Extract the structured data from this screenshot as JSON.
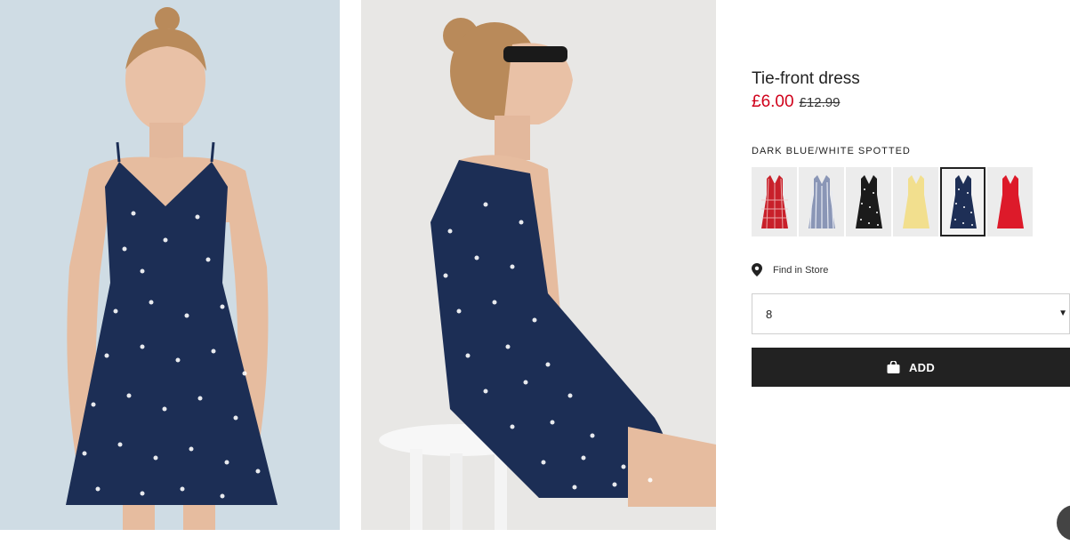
{
  "product": {
    "title": "Tie-front dress",
    "price_now": "£6.00",
    "price_was": "£12.99",
    "color_label": "DARK BLUE/WHITE SPOTTED"
  },
  "swatches": [
    {
      "name": "red-check",
      "color": "#c8202a",
      "selected": false
    },
    {
      "name": "blue-stripe",
      "color": "#8a96b6",
      "selected": false
    },
    {
      "name": "black-spotted",
      "color": "#1b1b1b",
      "selected": false
    },
    {
      "name": "yellow",
      "color": "#f2df8e",
      "selected": false
    },
    {
      "name": "dark-blue-spotted",
      "color": "#1e2f56",
      "selected": true
    },
    {
      "name": "red",
      "color": "#dd1a2a",
      "selected": false
    }
  ],
  "store": {
    "label": "Find in Store",
    "icon": "location-pin-icon"
  },
  "size_select": {
    "value": "8",
    "icon": "caret-down-icon"
  },
  "add_button": {
    "label": "ADD",
    "icon": "shopping-bag-icon"
  },
  "colors": {
    "price_red": "#d0021b",
    "button_bg": "#222222",
    "dress_navy": "#1c2e55"
  }
}
